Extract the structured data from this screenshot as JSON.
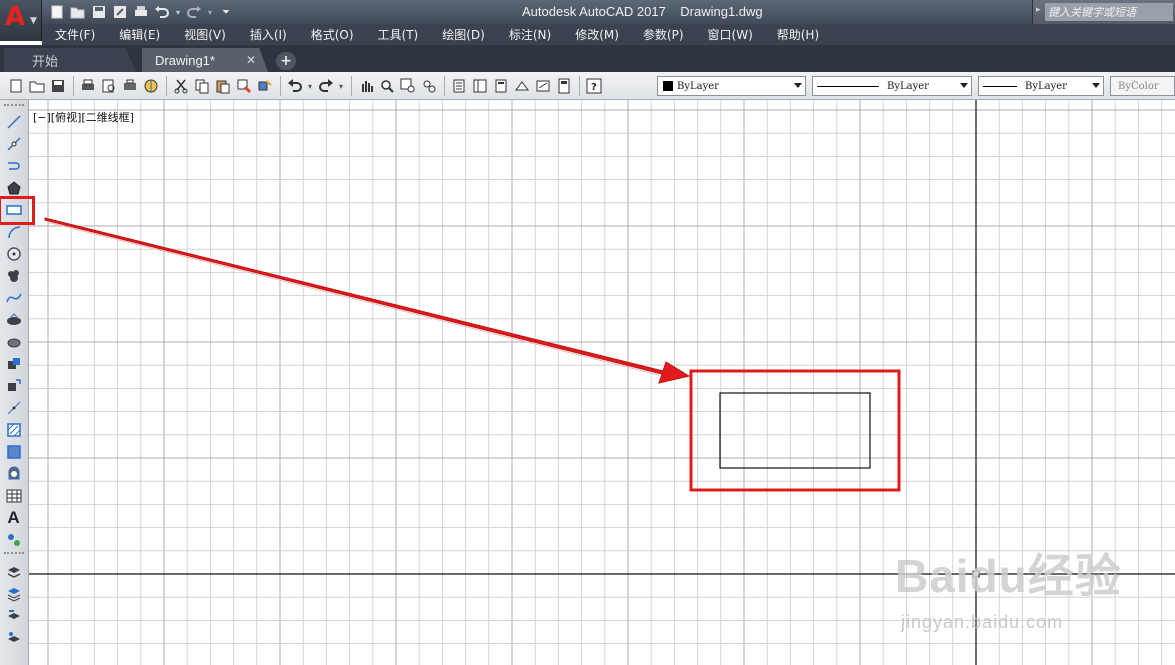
{
  "app": {
    "logo_letter": "A",
    "title": "Autodesk AutoCAD 2017    Drawing1.dwg"
  },
  "search": {
    "placeholder": "键入关键字或短语"
  },
  "menu": [
    "文件(F)",
    "编辑(E)",
    "视图(V)",
    "插入(I)",
    "格式(O)",
    "工具(T)",
    "绘图(D)",
    "标注(N)",
    "修改(M)",
    "参数(P)",
    "窗口(W)",
    "帮助(H)"
  ],
  "tabs": {
    "start": "开始",
    "drawing": "Drawing1*",
    "close_glyph": "✕",
    "add_glyph": "+"
  },
  "properties": {
    "color": "ByLayer",
    "linetype": "ByLayer",
    "lineweight": "ByLayer",
    "plotstyle": "ByColor"
  },
  "viewport": {
    "label": "[−][俯视][二维线框]"
  },
  "left_toolbar": {
    "text_tool_glyph": "A"
  },
  "watermark": {
    "text": "Baidu经验",
    "url": "jingyan.baidu.com"
  },
  "colors": {
    "highlight": "#e01b1b",
    "grid_minor": "#c9ccd4",
    "grid_major": "#a9adb8"
  }
}
